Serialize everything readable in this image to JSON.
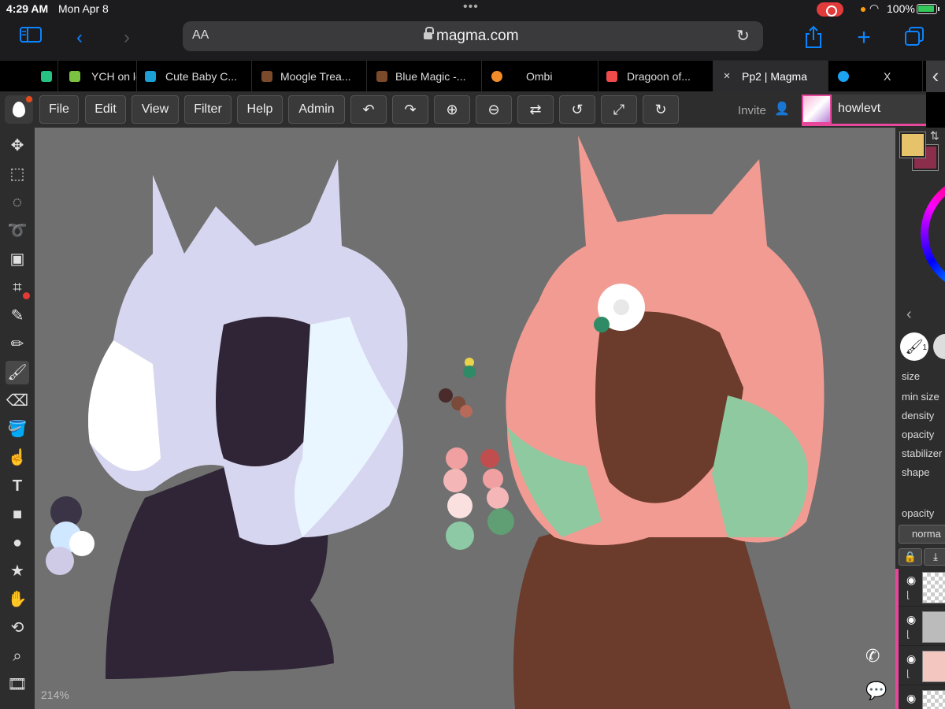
{
  "status": {
    "time": "4:29 AM",
    "date": "Mon Apr 8",
    "battery": "100%"
  },
  "browser": {
    "url": "magma.com",
    "text_size_label": "AA",
    "tabs": [
      {
        "label": "",
        "favicon_color": "#26c281"
      },
      {
        "label": "YCH on le",
        "favicon_color": "#7cc242"
      },
      {
        "label": "Cute Baby C...",
        "favicon_color": "#1b9fd4"
      },
      {
        "label": "Moogle Trea...",
        "favicon_color": "#7a4a2a"
      },
      {
        "label": "Blue Magic -...",
        "favicon_color": "#7a4a2a"
      },
      {
        "label": "Ombi",
        "favicon_color": "#f28c28"
      },
      {
        "label": "Dragoon of...",
        "favicon_color": "#f04b4b"
      },
      {
        "label": "Pp2 | Magma",
        "favicon_color": "#666666"
      },
      {
        "label": "X",
        "favicon_color": "#1da1f2"
      }
    ]
  },
  "magma": {
    "menu": [
      "File",
      "Edit",
      "View",
      "Filter",
      "Help",
      "Admin"
    ],
    "invite_label": "Invite",
    "username": "howlevt",
    "zoom": "214%",
    "accent_color": "#e8489b",
    "primary_color": "#e6c36a",
    "secondary_color": "#8a2e4c",
    "brush_props": [
      "size",
      "min size",
      "density",
      "opacity",
      "stabilizer",
      "shape"
    ],
    "layer_opacity_label": "opacity",
    "blend_mode": "norma",
    "brush_number": "1"
  }
}
